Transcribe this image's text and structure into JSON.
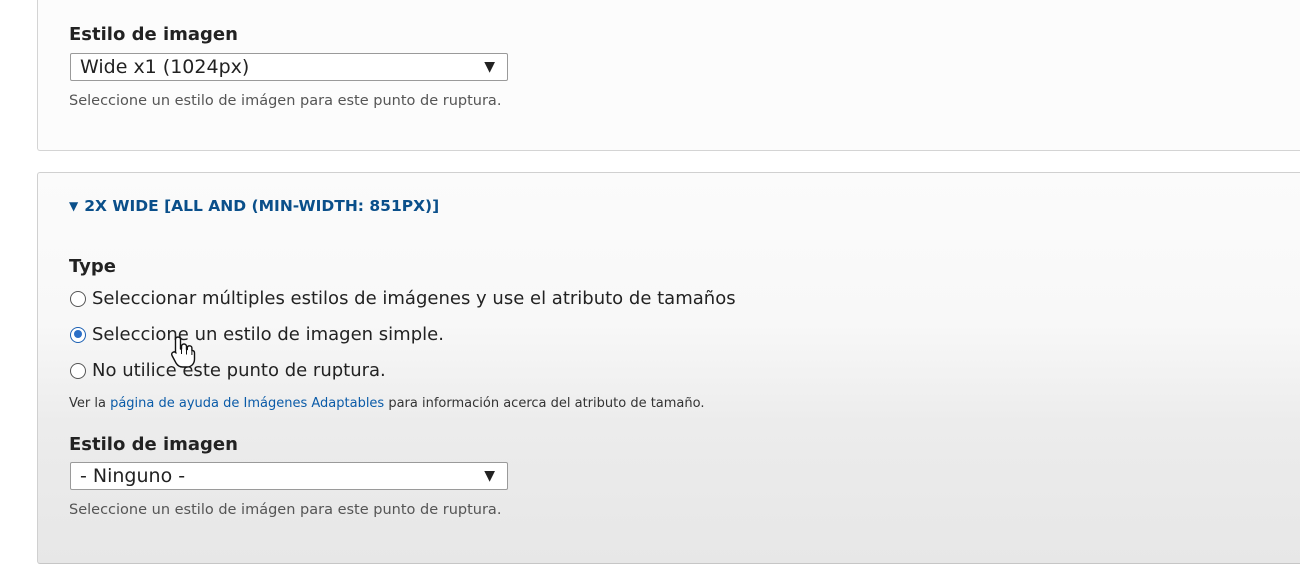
{
  "top_section": {
    "image_style_label": "Estilo de imagen",
    "image_style_value": "Wide x1 (1024px)",
    "image_style_description": "Seleccione un estilo de imágen para este punto de ruptura."
  },
  "breakpoint_section": {
    "summary_label": "2X WIDE [ALL AND (MIN-WIDTH: 851PX)]",
    "type_label": "Type",
    "options": [
      {
        "label": "Seleccionar múltiples estilos de imágenes y use el atributo de tamaños",
        "checked": false
      },
      {
        "label": "Seleccione un estilo de imagen simple.",
        "checked": true
      },
      {
        "label": "No utilice este punto de ruptura.",
        "checked": false
      }
    ],
    "help_prefix": "Ver la ",
    "help_link": "página de ayuda de Imágenes Adaptables",
    "help_suffix": " para información acerca del atributo de tamaño.",
    "image_style_label": "Estilo de imagen",
    "image_style_value": "- Ninguno -",
    "image_style_description": "Seleccione un estilo de imágen para este punto de ruptura."
  },
  "icons": {
    "dropdown": "triangle-down",
    "summary": "triangle-down",
    "cursor": "hand-pointer"
  },
  "colors": {
    "link": "#0a5ba8",
    "summary": "#0a4f8a",
    "radio_checked": "#2b6fc7"
  }
}
